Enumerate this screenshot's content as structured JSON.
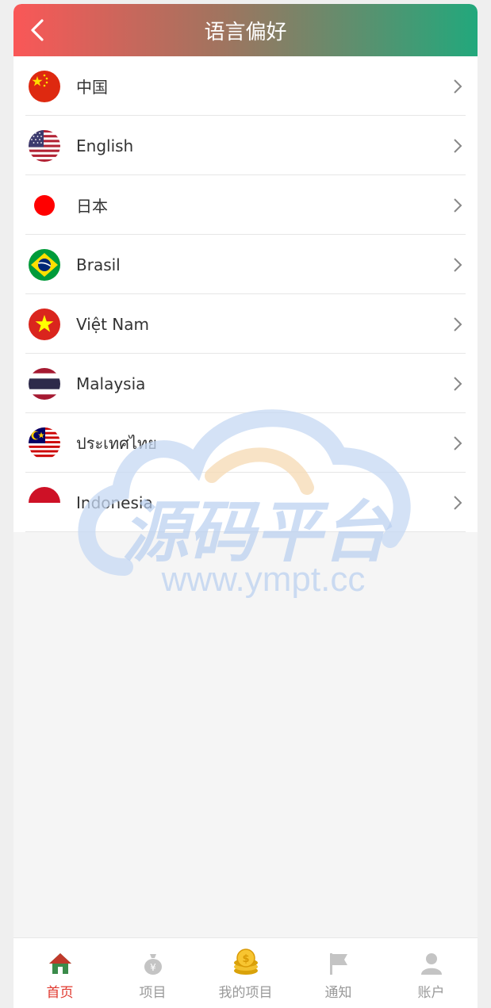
{
  "header": {
    "title": "语言偏好"
  },
  "languages": [
    {
      "label": "中国",
      "flag": "china-flag"
    },
    {
      "label": "English",
      "flag": "usa-flag"
    },
    {
      "label": "日本",
      "flag": "japan-flag"
    },
    {
      "label": "Brasil",
      "flag": "brazil-flag"
    },
    {
      "label": "Việt Nam",
      "flag": "vietnam-flag"
    },
    {
      "label": "Malaysia",
      "flag": "thailand-flag"
    },
    {
      "label": "ประเทศไทย",
      "flag": "malaysia-flag"
    },
    {
      "label": "Indonesia",
      "flag": "indonesia-flag"
    }
  ],
  "watermark": {
    "big": "源码平台",
    "url": "www.ympt.cc"
  },
  "tabbar": [
    {
      "label": "首页",
      "icon": "home-icon",
      "active": true
    },
    {
      "label": "项目",
      "icon": "money-bag-icon"
    },
    {
      "label": "我的项目",
      "icon": "coins-icon"
    },
    {
      "label": "通知",
      "icon": "flag-icon"
    },
    {
      "label": "账户",
      "icon": "user-icon"
    }
  ],
  "colors": {
    "active": "#e0382e",
    "inactive": "#999999",
    "header_start": "#fa5757",
    "header_end": "#22a87c"
  }
}
